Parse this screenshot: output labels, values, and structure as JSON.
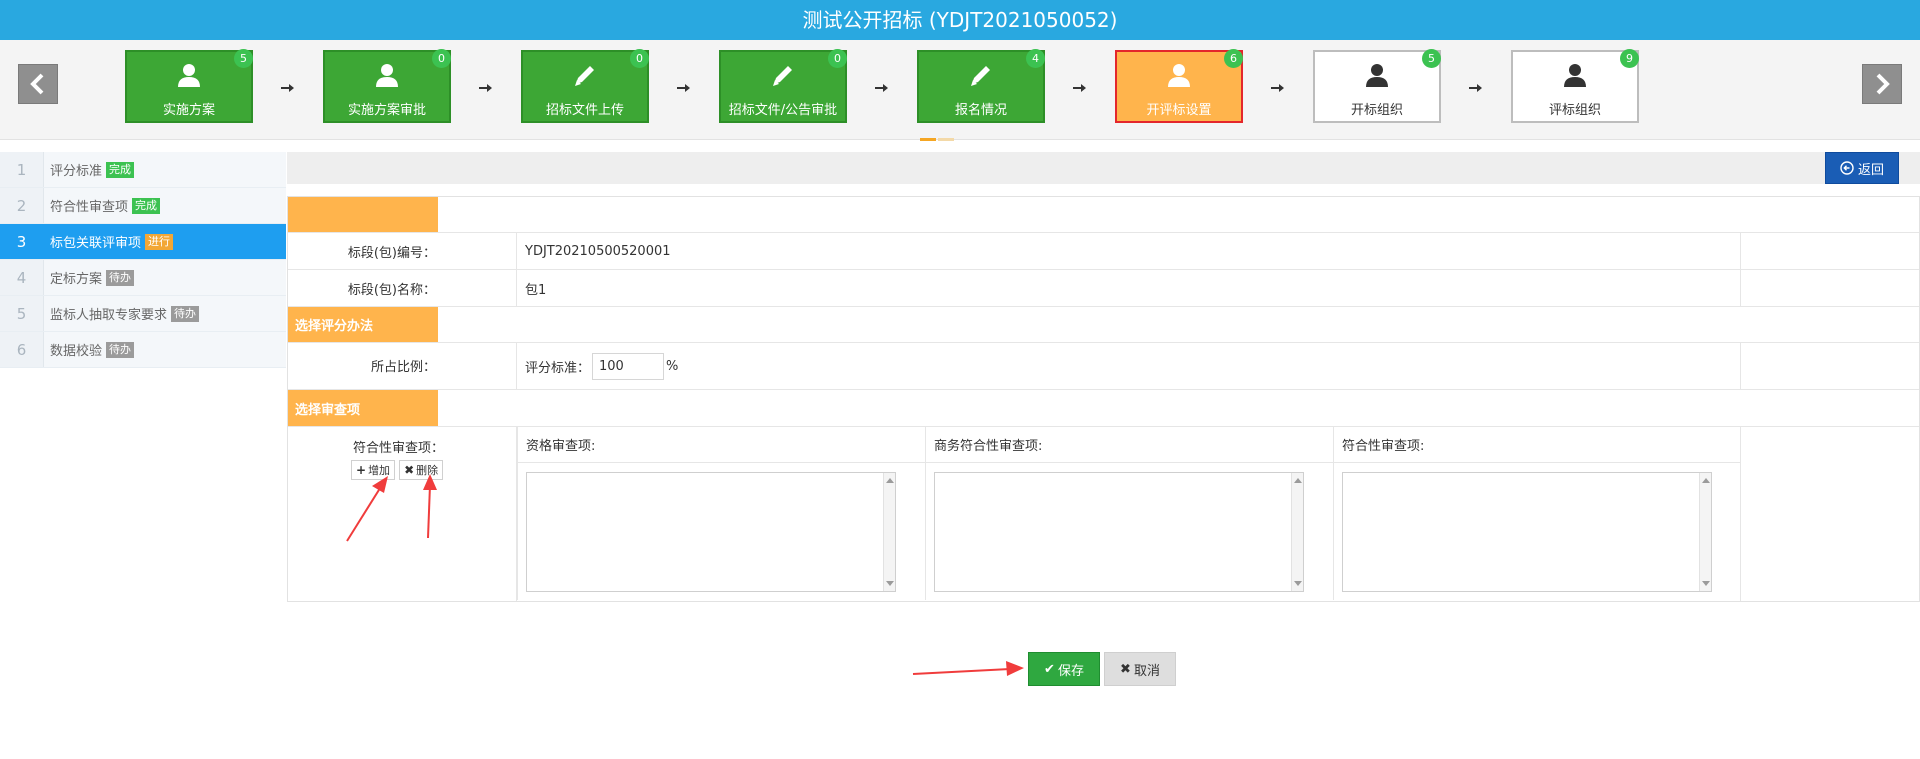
{
  "title": "测试公开招标 (YDJT2021050052)",
  "steps": [
    {
      "label": "实施方案",
      "badge": "5",
      "icon": "user-icon",
      "state": "green"
    },
    {
      "label": "实施方案审批",
      "badge": "0",
      "icon": "user-icon",
      "state": "green"
    },
    {
      "label": "招标文件上传",
      "badge": "0",
      "icon": "pencil-icon",
      "state": "green"
    },
    {
      "label": "招标文件/公告审批",
      "badge": "0",
      "icon": "pencil-icon",
      "state": "green"
    },
    {
      "label": "报名情况",
      "badge": "4",
      "icon": "pencil-icon",
      "state": "green"
    },
    {
      "label": "开评标设置",
      "badge": "6",
      "icon": "user-icon",
      "state": "orange"
    },
    {
      "label": "开标组织",
      "badge": "5",
      "icon": "user-icon",
      "state": "white"
    },
    {
      "label": "评标组织",
      "badge": "9",
      "icon": "user-icon",
      "state": "white"
    }
  ],
  "sidebar": {
    "items": [
      {
        "num": "1",
        "label": "评分标准",
        "tag": "完成",
        "status": "done"
      },
      {
        "num": "2",
        "label": "符合性审查项",
        "tag": "完成",
        "status": "done"
      },
      {
        "num": "3",
        "label": "标包关联评审项",
        "tag": "进行",
        "status": "doing"
      },
      {
        "num": "4",
        "label": "定标方案",
        "tag": "待办",
        "status": "todo"
      },
      {
        "num": "5",
        "label": "监标人抽取专家要求",
        "tag": "待办",
        "status": "todo"
      },
      {
        "num": "6",
        "label": "数据校验",
        "tag": "待办",
        "status": "todo"
      }
    ]
  },
  "toolbar": {
    "back_label": "返回"
  },
  "form": {
    "section_blank": "",
    "bid_no_label": "标段(包)编号：",
    "bid_no_value": "YDJT20210500520001",
    "bid_name_label": "标段(包)名称：",
    "bid_name_value": "包1",
    "section_method": "选择评分办法",
    "ratio_label": "所占比例：",
    "ratio_prefix": "评分标准：",
    "ratio_value": "100",
    "ratio_unit": "%",
    "section_review": "选择审查项",
    "review_label": "符合性审查项：",
    "add_label": "增加",
    "delete_label": "删除",
    "review_columns": [
      {
        "header": "资格审查项:"
      },
      {
        "header": "商务符合性审查项:"
      },
      {
        "header": "符合性审查项:"
      }
    ]
  },
  "actions": {
    "save_label": "保存",
    "cancel_label": "取消"
  },
  "colors": {
    "title_bg": "#29a8e0",
    "step_green": "#3da735",
    "step_orange": "#ffb44c",
    "active_border": "#e4262b",
    "badge": "#3cc251",
    "sidebar_active": "#1e9ef0",
    "section_tab": "#ffb44c",
    "back_button": "#1a5db5",
    "save_button": "#2fa840",
    "annotation_arrow": "#f03c3c"
  }
}
